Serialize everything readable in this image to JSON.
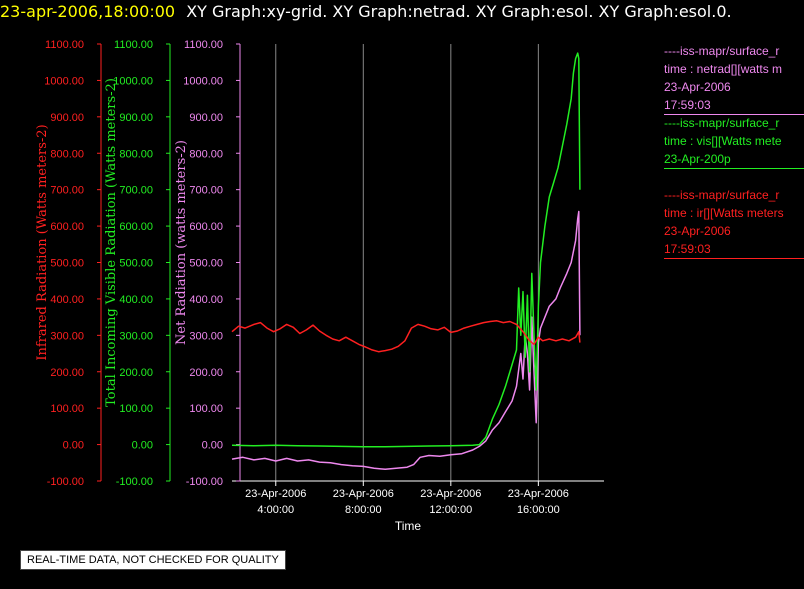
{
  "header": {
    "timestamp": "23-apr-2006,18:00:00",
    "titles": "XY Graph:xy-grid.  XY Graph:netrad.  XY Graph:esol.  XY Graph:esol.0."
  },
  "notice": "REAL-TIME DATA, NOT CHECKED FOR QUALITY",
  "colors": {
    "ir": "#ff2020",
    "vis": "#22ee22",
    "net": "#ee88ee",
    "axis": "#ffffff",
    "grid": "#888888"
  },
  "legend": [
    {
      "lines": [
        "----iss-mapr/surface_r",
        "time : netrad[][watts m",
        "23-Apr-2006",
        "17:59:03"
      ],
      "color": "#ee88ee"
    },
    {
      "lines": [
        "----iss-mapr/surface_r",
        "time : vis[][Watts mete",
        "23-Apr-200p"
      ],
      "color": "#22ee22"
    },
    {
      "lines": [
        "----iss-mapr/surface_r",
        "time : ir[][Watts meters",
        "23-Apr-2006",
        "17:59:03"
      ],
      "color": "#ff2020"
    }
  ],
  "chart_data": {
    "type": "line",
    "xlabel": "Time",
    "x_ticks": [
      {
        "date": "23-Apr-2006",
        "time": "4:00:00",
        "hour": 4
      },
      {
        "date": "23-Apr-2006",
        "time": "8:00:00",
        "hour": 8
      },
      {
        "date": "23-Apr-2006",
        "time": "12:00:00",
        "hour": 12
      },
      {
        "date": "23-Apr-2006",
        "time": "16:00:00",
        "hour": 16
      }
    ],
    "xlim_hours": [
      2.0,
      19.0
    ],
    "ylim": [
      -100,
      1100
    ],
    "y_ticks": [
      "-100.00",
      "0.00",
      "100.00",
      "200.00",
      "300.00",
      "400.00",
      "500.00",
      "600.00",
      "700.00",
      "800.00",
      "900.00",
      "1000.00",
      "1100.00"
    ],
    "axes": [
      {
        "key": "ir",
        "label": "Infrared Radiation (Watts meters-2)",
        "color": "#ff2020"
      },
      {
        "key": "vis",
        "label": "Total Incoming Visible Radiation (Watts meters-2)",
        "color": "#22ee22"
      },
      {
        "key": "net",
        "label": "Net Radiation (watts meters-2)",
        "color": "#ee88ee"
      }
    ],
    "series": [
      {
        "key": "net",
        "values": [
          [
            2.0,
            -40
          ],
          [
            2.5,
            -35
          ],
          [
            3.0,
            -42
          ],
          [
            3.5,
            -38
          ],
          [
            4.0,
            -45
          ],
          [
            4.5,
            -38
          ],
          [
            5.0,
            -45
          ],
          [
            5.5,
            -42
          ],
          [
            6.0,
            -48
          ],
          [
            6.5,
            -50
          ],
          [
            7.0,
            -55
          ],
          [
            7.5,
            -58
          ],
          [
            8.0,
            -60
          ],
          [
            8.5,
            -65
          ],
          [
            9.0,
            -68
          ],
          [
            9.5,
            -65
          ],
          [
            10.0,
            -62
          ],
          [
            10.3,
            -55
          ],
          [
            10.6,
            -35
          ],
          [
            11.0,
            -30
          ],
          [
            11.5,
            -32
          ],
          [
            12.0,
            -28
          ],
          [
            12.5,
            -25
          ],
          [
            13.0,
            -15
          ],
          [
            13.3,
            -5
          ],
          [
            13.6,
            10
          ],
          [
            13.9,
            40
          ],
          [
            14.2,
            60
          ],
          [
            14.5,
            90
          ],
          [
            14.8,
            120
          ],
          [
            15.0,
            160
          ],
          [
            15.2,
            250
          ],
          [
            15.3,
            180
          ],
          [
            15.4,
            300
          ],
          [
            15.5,
            250
          ],
          [
            15.6,
            150
          ],
          [
            15.7,
            350
          ],
          [
            15.8,
            200
          ],
          [
            15.9,
            60
          ],
          [
            16.0,
            280
          ],
          [
            16.1,
            320
          ],
          [
            16.3,
            350
          ],
          [
            16.5,
            380
          ],
          [
            16.8,
            400
          ],
          [
            17.0,
            430
          ],
          [
            17.3,
            470
          ],
          [
            17.5,
            500
          ],
          [
            17.7,
            560
          ],
          [
            17.8,
            620
          ],
          [
            17.85,
            640
          ],
          [
            17.9,
            300
          ]
        ]
      },
      {
        "key": "vis",
        "values": [
          [
            2.0,
            -2
          ],
          [
            3.0,
            -3
          ],
          [
            4.0,
            -2
          ],
          [
            5.0,
            -3
          ],
          [
            6.0,
            -4
          ],
          [
            7.0,
            -5
          ],
          [
            8.0,
            -6
          ],
          [
            9.0,
            -6
          ],
          [
            10.0,
            -5
          ],
          [
            11.0,
            -4
          ],
          [
            12.0,
            -3
          ],
          [
            13.0,
            -2
          ],
          [
            13.3,
            0
          ],
          [
            13.6,
            20
          ],
          [
            13.9,
            70
          ],
          [
            14.2,
            110
          ],
          [
            14.5,
            160
          ],
          [
            14.8,
            220
          ],
          [
            15.0,
            260
          ],
          [
            15.1,
            430
          ],
          [
            15.2,
            300
          ],
          [
            15.3,
            420
          ],
          [
            15.4,
            240
          ],
          [
            15.5,
            410
          ],
          [
            15.6,
            200
          ],
          [
            15.7,
            470
          ],
          [
            15.8,
            300
          ],
          [
            15.9,
            150
          ],
          [
            16.0,
            380
          ],
          [
            16.1,
            500
          ],
          [
            16.2,
            550
          ],
          [
            16.3,
            600
          ],
          [
            16.4,
            640
          ],
          [
            16.5,
            680
          ],
          [
            16.7,
            720
          ],
          [
            16.9,
            760
          ],
          [
            17.1,
            820
          ],
          [
            17.3,
            880
          ],
          [
            17.5,
            950
          ],
          [
            17.6,
            1020
          ],
          [
            17.7,
            1060
          ],
          [
            17.8,
            1075
          ],
          [
            17.85,
            1060
          ],
          [
            17.9,
            700
          ]
        ]
      },
      {
        "key": "ir",
        "values": [
          [
            2.0,
            310
          ],
          [
            2.3,
            325
          ],
          [
            2.6,
            320
          ],
          [
            3.0,
            330
          ],
          [
            3.3,
            335
          ],
          [
            3.6,
            320
          ],
          [
            3.9,
            310
          ],
          [
            4.2,
            318
          ],
          [
            4.5,
            330
          ],
          [
            4.8,
            322
          ],
          [
            5.1,
            305
          ],
          [
            5.4,
            315
          ],
          [
            5.7,
            328
          ],
          [
            6.0,
            312
          ],
          [
            6.3,
            300
          ],
          [
            6.6,
            290
          ],
          [
            6.9,
            285
          ],
          [
            7.2,
            295
          ],
          [
            7.5,
            285
          ],
          [
            7.8,
            275
          ],
          [
            8.1,
            268
          ],
          [
            8.4,
            260
          ],
          [
            8.7,
            255
          ],
          [
            9.0,
            258
          ],
          [
            9.3,
            262
          ],
          [
            9.6,
            270
          ],
          [
            9.9,
            285
          ],
          [
            10.2,
            320
          ],
          [
            10.5,
            330
          ],
          [
            10.8,
            325
          ],
          [
            11.1,
            318
          ],
          [
            11.4,
            315
          ],
          [
            11.7,
            322
          ],
          [
            12.0,
            308
          ],
          [
            12.3,
            312
          ],
          [
            12.6,
            320
          ],
          [
            12.9,
            325
          ],
          [
            13.2,
            330
          ],
          [
            13.5,
            335
          ],
          [
            13.8,
            338
          ],
          [
            14.1,
            340
          ],
          [
            14.4,
            335
          ],
          [
            14.7,
            338
          ],
          [
            15.0,
            330
          ],
          [
            15.3,
            310
          ],
          [
            15.6,
            285
          ],
          [
            15.8,
            275
          ],
          [
            16.0,
            295
          ],
          [
            16.2,
            285
          ],
          [
            16.5,
            290
          ],
          [
            16.8,
            285
          ],
          [
            17.1,
            290
          ],
          [
            17.4,
            285
          ],
          [
            17.7,
            295
          ],
          [
            17.85,
            310
          ],
          [
            17.9,
            280
          ]
        ]
      }
    ]
  }
}
